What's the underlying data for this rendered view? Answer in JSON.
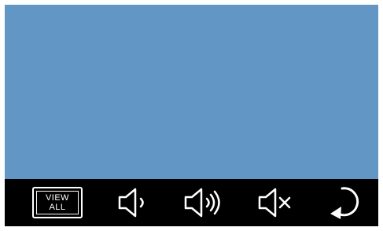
{
  "colors": {
    "video_background": "#6297c5",
    "control_bar": "#000000",
    "icon": "#ffffff"
  },
  "view_all": {
    "line1": "VIEW",
    "line2": "ALL"
  },
  "controls": [
    {
      "icon": "view-all-icon"
    },
    {
      "icon": "volume-down-icon"
    },
    {
      "icon": "volume-up-icon"
    },
    {
      "icon": "mute-icon"
    },
    {
      "icon": "back-arrow-icon"
    }
  ]
}
